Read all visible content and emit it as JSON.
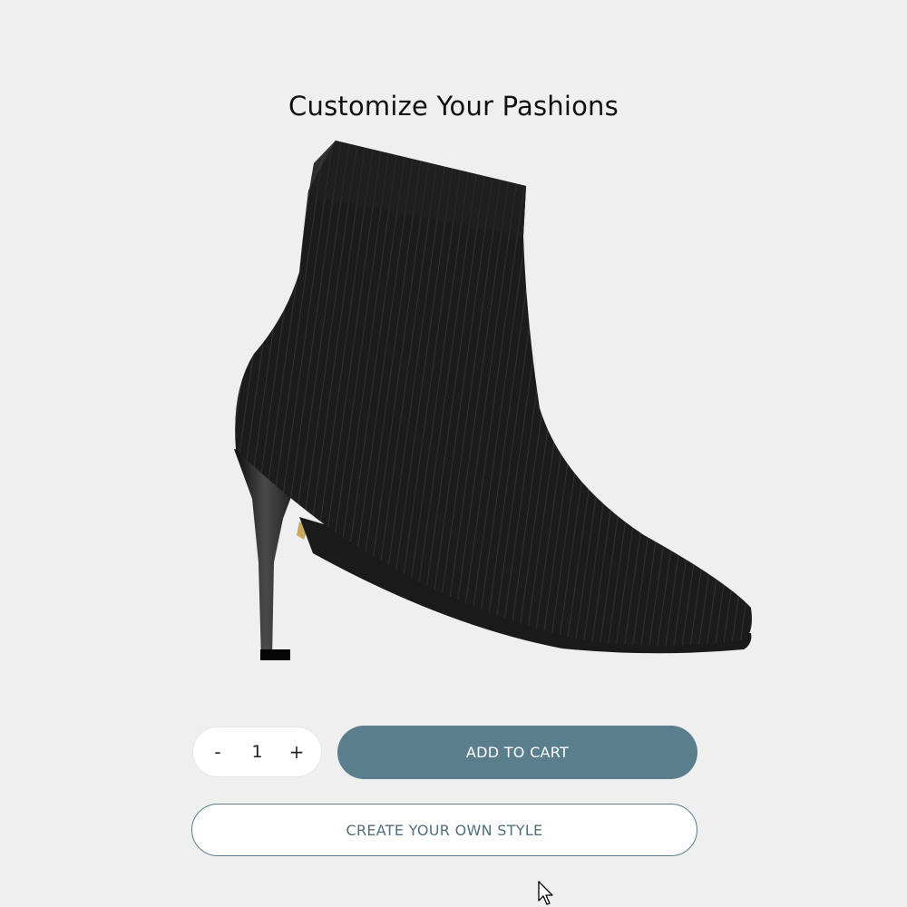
{
  "page": {
    "title": "Customize Your Pashions"
  },
  "product": {
    "image_icon": "ankle-boot-image"
  },
  "quantity": {
    "decrement_label": "-",
    "value": "1",
    "increment_label": "+"
  },
  "actions": {
    "add_to_cart_label": "ADD TO CART",
    "create_style_label": "CREATE YOUR OWN STYLE"
  },
  "colors": {
    "accent": "#5a7e8c",
    "background": "#efefef"
  }
}
